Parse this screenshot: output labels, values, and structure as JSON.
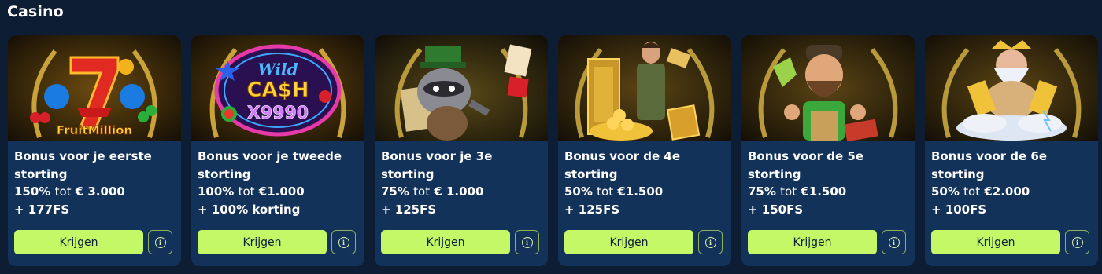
{
  "section": {
    "title": "Casino"
  },
  "button_label": "Krijgen",
  "info_glyph": "i",
  "cards": [
    {
      "title": "Bonus voor je eerste storting",
      "pct": "150%",
      "tot": "tot",
      "amount": "€ 3.000",
      "extra": "+ 177FS",
      "game": "FruitMillion",
      "icon": "lucky-seven-slot-icon"
    },
    {
      "title": "Bonus voor je tweede storting",
      "pct": "100%",
      "tot": "tot",
      "amount": "€1.000",
      "extra": "+ 100% korting",
      "game": "Wild Cash X9990",
      "icon": "wild-cash-slot-icon"
    },
    {
      "title": "Bonus voor je 3e storting",
      "pct": "75%",
      "tot": "tot",
      "amount": "€ 1.000",
      "extra": "+ 125FS",
      "game": "",
      "icon": "raccoon-slot-icon"
    },
    {
      "title": "Bonus voor de 4e storting",
      "pct": "50%",
      "tot": "tot",
      "amount": "€1.500",
      "extra": "+ 125FS",
      "game": "",
      "icon": "explorer-slot-icon"
    },
    {
      "title": "Bonus voor de 5e storting",
      "pct": "75%",
      "tot": "tot",
      "amount": "€1.500",
      "extra": "+ 150FS",
      "game": "",
      "icon": "lumberjack-slot-icon"
    },
    {
      "title": "Bonus voor de 6e storting",
      "pct": "50%",
      "tot": "tot",
      "amount": "€2.000",
      "extra": "+ 100FS",
      "game": "",
      "icon": "zeus-slot-icon"
    }
  ],
  "colors": {
    "page_bg": "#0d1d33",
    "card_bg": "#13325a",
    "accent": "#c4f867",
    "gold": "#e0b23a"
  }
}
